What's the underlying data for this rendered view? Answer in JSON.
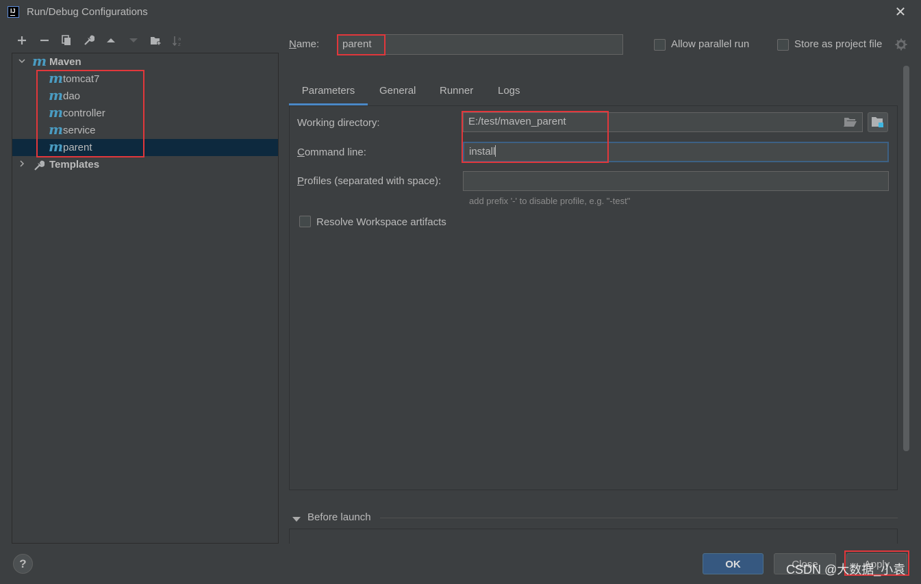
{
  "window": {
    "title": "Run/Debug Configurations",
    "close_symbol": "✕"
  },
  "toolbar": {
    "add": "+",
    "remove": "−"
  },
  "tree": {
    "root": {
      "label": "Maven"
    },
    "items": [
      {
        "label": "tomcat7"
      },
      {
        "label": "dao"
      },
      {
        "label": "controller"
      },
      {
        "label": "service"
      },
      {
        "label": "parent",
        "selected": true
      }
    ],
    "templates": {
      "label": "Templates"
    },
    "icon_glyph": "m"
  },
  "config": {
    "name_label": "Name:",
    "name_value": "parent",
    "allow_parallel_label": "Allow parallel run",
    "allow_parallel_checked": false,
    "store_project_label": "Store as project file",
    "store_project_checked": false
  },
  "tabs": [
    {
      "label": "Parameters",
      "active": true
    },
    {
      "label": "General"
    },
    {
      "label": "Runner"
    },
    {
      "label": "Logs"
    }
  ],
  "parameters": {
    "working_dir_label": "Working directory:",
    "working_dir_value": "E:/test/maven_parent",
    "command_line_label": "Command line:",
    "command_line_value": "install",
    "profiles_label": "Profiles (separated with space):",
    "profiles_value": "",
    "profiles_hint": "add prefix '-' to disable profile, e.g. \"-test\"",
    "resolve_workspace_label": "Resolve Workspace artifacts",
    "resolve_workspace_checked": false
  },
  "before_launch": {
    "label": "Before launch"
  },
  "buttons": {
    "help": "?",
    "ok": "OK",
    "close": "Close",
    "apply": "Apply"
  },
  "watermark": "CSDN @大数据_小袁",
  "colors": {
    "background": "#3c3f41",
    "selection": "#0d293e",
    "accent": "#4a88c7",
    "highlight_box": "#e2373b",
    "maven_icon": "#4a9cc2"
  }
}
